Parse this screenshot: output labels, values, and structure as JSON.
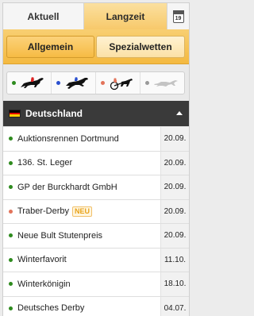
{
  "tabs": {
    "aktuell": "Aktuell",
    "langzeit": "Langzeit",
    "calendar_day": "19"
  },
  "subtabs": {
    "allgemein": "Allgemein",
    "spezialwetten": "Spezialwetten"
  },
  "race_types": [
    {
      "name": "galopp",
      "icon": "horse-jockey-icon",
      "color": "#2e8b1e"
    },
    {
      "name": "hindernis",
      "icon": "horse-jump-icon",
      "color": "#2a4fcf"
    },
    {
      "name": "traber",
      "icon": "trotter-sulky-icon",
      "color": "#e2735a"
    },
    {
      "name": "windhund",
      "icon": "greyhound-icon",
      "color": "#9a9a9a"
    }
  ],
  "country": {
    "name": "Deutschland",
    "flag_colors": [
      "#000000",
      "#dd0000",
      "#ffce00"
    ]
  },
  "races": [
    {
      "name": "Auktionsrennen Dortmund",
      "date": "20.09.",
      "dot_color": "#2e8b1e"
    },
    {
      "name": "136. St. Leger",
      "date": "20.09.",
      "dot_color": "#2e8b1e"
    },
    {
      "name": "GP der Burckhardt GmbH",
      "date": "20.09.",
      "dot_color": "#2e8b1e"
    },
    {
      "name": "Traber-Derby",
      "date": "20.09.",
      "dot_color": "#e2735a",
      "badge": "NEU"
    },
    {
      "name": "Neue Bult Stutenpreis",
      "date": "20.09.",
      "dot_color": "#2e8b1e"
    },
    {
      "name": "Winterfavorit",
      "date": "11.10.",
      "dot_color": "#2e8b1e"
    },
    {
      "name": "Winterkönigin",
      "date": "18.10.",
      "dot_color": "#2e8b1e"
    },
    {
      "name": "Deutsches Derby",
      "date": "04.07.",
      "dot_color": "#2e8b1e"
    }
  ]
}
